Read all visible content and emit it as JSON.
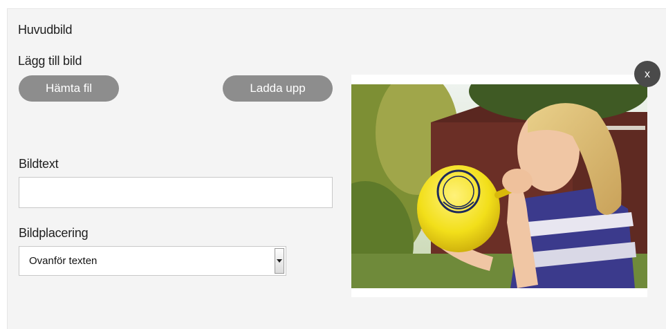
{
  "section": {
    "title": "Huvudbild"
  },
  "upload": {
    "label": "Lägg till bild",
    "fetch_label": "Hämta fil",
    "upload_label": "Ladda upp"
  },
  "caption": {
    "label": "Bildtext",
    "value": ""
  },
  "placement": {
    "label": "Bildplacering",
    "selected": "Ovanför texten"
  },
  "preview": {
    "close_label": "x",
    "image_subject": "girl-blowing-yellow-balloon"
  },
  "colors": {
    "panel_bg": "#f4f4f4",
    "button_bg": "#8d8d8d",
    "close_bg": "#4a4a4a",
    "balloon": "#f2df1a"
  }
}
